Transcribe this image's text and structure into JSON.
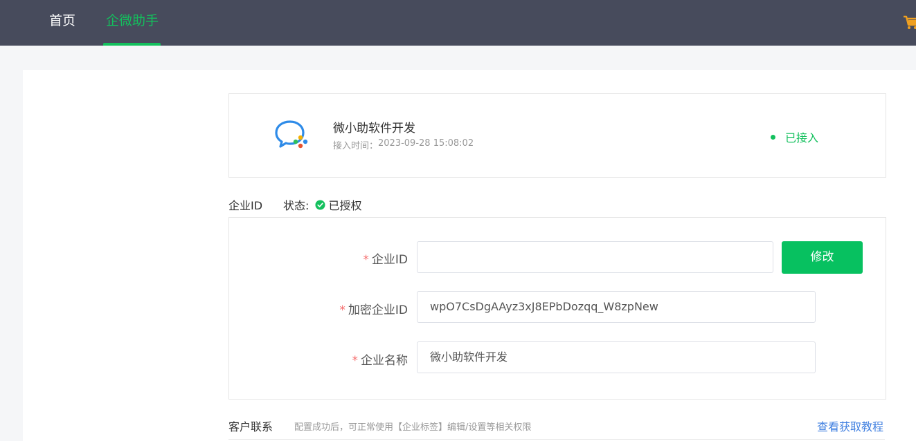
{
  "nav": {
    "home": "首页",
    "active": "企微助手"
  },
  "connection": {
    "corp_name": "微小助软件开发",
    "time_label": "接入时间：",
    "time_value": "2023-09-28 15:08:02",
    "status": "已接入"
  },
  "section": {
    "title": "企业ID",
    "status_label": "状态:",
    "status_value": "已授权"
  },
  "form": {
    "corp_id_label": "企业ID",
    "corp_id_value": "",
    "modify_button": "修改",
    "encrypted_id_label": "加密企业ID",
    "encrypted_id_value": "wpO7CsDgAAyz3xJ8EPbDozqq_W8zpNew",
    "corp_name_label": "企业名称",
    "corp_name_value": "微小助软件开发",
    "required_mark": "*"
  },
  "contact": {
    "title": "客户联系",
    "description": "配置成功后，可正常使用【企业标签】编辑/设置等相关权限",
    "tutorial_link": "查看获取教程"
  },
  "colors": {
    "accent_green": "#13c05d",
    "button_green": "#07c160",
    "topbar": "#474b5c",
    "link_blue": "#3f7fe0",
    "required_red": "#f56c6c"
  },
  "icons": {
    "logo": "wecom-logo-icon",
    "cart": "cart-icon",
    "check": "check-circle-icon",
    "status_dot": "status-dot-icon"
  }
}
